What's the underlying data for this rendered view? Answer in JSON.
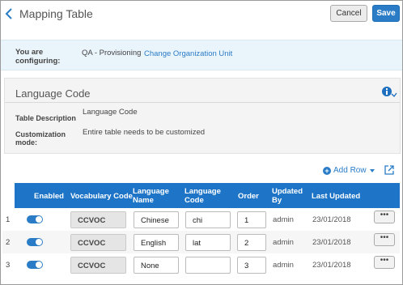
{
  "header": {
    "title": "Mapping Table",
    "cancel_label": "Cancel",
    "save_label": "Save"
  },
  "config": {
    "label": "You are configuring:",
    "value": "QA - Provisioning",
    "link": "Change Organization Unit"
  },
  "panel": {
    "title": "Language Code",
    "desc_label": "Table Description",
    "desc_value": "Language Code",
    "mode_label": "Customization mode:",
    "mode_value": "Entire table needs to be customized"
  },
  "toolbar": {
    "add_row_label": "Add Row"
  },
  "table": {
    "headers": {
      "enabled": "Enabled",
      "vocab": "Vocabulary Code",
      "name": "Language Name",
      "code": "Language Code",
      "order": "Order",
      "updated_by": "Updated By",
      "last_updated": "Last Updated"
    },
    "rows": [
      {
        "num": "1",
        "enabled": true,
        "vocab": "CCVOC",
        "name": "Chinese",
        "code": "chi",
        "order": "1",
        "updated_by": "admin",
        "last_updated": "23/01/2018"
      },
      {
        "num": "2",
        "enabled": true,
        "vocab": "CCVOC",
        "name": "English",
        "code": "lat",
        "order": "2",
        "updated_by": "admin",
        "last_updated": "23/01/2018"
      },
      {
        "num": "3",
        "enabled": true,
        "vocab": "CCVOC",
        "name": "None",
        "code": "",
        "order": "3",
        "updated_by": "admin",
        "last_updated": "23/01/2018"
      }
    ]
  },
  "colors": {
    "accent": "#2a7cc7",
    "header_bg": "#1e75c8",
    "banner_bg": "#eaf4fb"
  }
}
